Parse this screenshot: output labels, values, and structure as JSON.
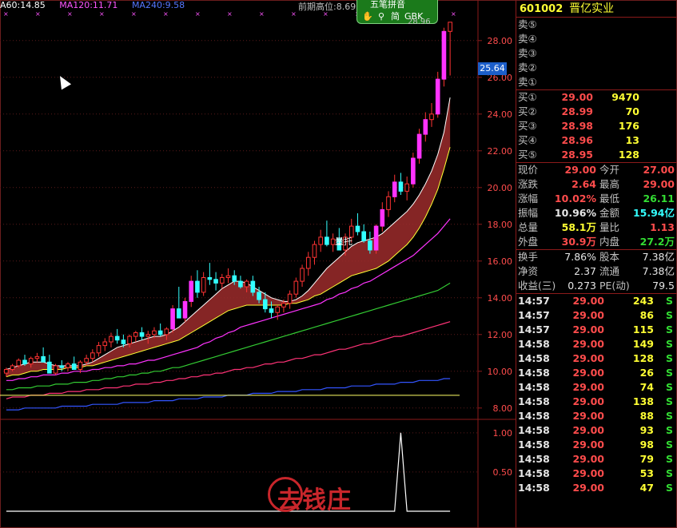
{
  "legend": [
    {
      "text": "A60:14.85",
      "color": "#ffffff"
    },
    {
      "text": "MA120:11.71",
      "color": "#ff55ff"
    },
    {
      "text": "MA240:9.58",
      "color": "#5577ff"
    }
  ],
  "prev_high_label": "前期高位:8.69",
  "toolbar": {
    "title": "五笔拼音",
    "simple": "简",
    "encoding": "GBK"
  },
  "current_price_tag": "25.64",
  "last_close_label": "28.96",
  "annotation": "量托",
  "colors": {
    "up": "#ff3333",
    "up_fill": "#ff33ff",
    "down": "#33ffff",
    "bg": "#000000",
    "grid": "#5a1a1a"
  },
  "chart_data": [
    {
      "type": "candlestick",
      "y_axis": {
        "ticks": [
          "28.00",
          "26.00",
          "24.00",
          "22.00",
          "20.00",
          "18.00",
          "16.00",
          "14.00",
          "12.00",
          "10.00",
          "8.00"
        ],
        "range": [
          7.6,
          29.6
        ]
      },
      "candles": [
        [
          9.9,
          10.2,
          9.7,
          10.1
        ],
        [
          10.1,
          10.4,
          10.0,
          10.3
        ],
        [
          10.3,
          10.7,
          10.2,
          10.6
        ],
        [
          10.6,
          10.9,
          10.3,
          10.4
        ],
        [
          10.4,
          10.8,
          10.2,
          10.7
        ],
        [
          10.7,
          11.0,
          10.5,
          10.8
        ],
        [
          10.8,
          11.3,
          10.6,
          10.5
        ],
        [
          10.5,
          10.9,
          10.2,
          9.9
        ],
        [
          9.9,
          10.4,
          9.8,
          10.3
        ],
        [
          10.3,
          10.6,
          10.0,
          10.2
        ],
        [
          10.2,
          10.5,
          10.0,
          10.4
        ],
        [
          10.4,
          10.8,
          10.2,
          10.1
        ],
        [
          10.1,
          10.6,
          9.9,
          10.5
        ],
        [
          10.5,
          10.9,
          10.3,
          10.7
        ],
        [
          10.7,
          11.2,
          10.5,
          11.0
        ],
        [
          11.0,
          11.6,
          10.8,
          11.4
        ],
        [
          11.4,
          11.8,
          11.1,
          11.6
        ],
        [
          11.6,
          12.1,
          11.3,
          11.9
        ],
        [
          11.9,
          12.3,
          11.5,
          11.7
        ],
        [
          11.7,
          12.0,
          11.3,
          11.5
        ],
        [
          11.5,
          12.0,
          11.3,
          11.9
        ],
        [
          11.9,
          12.2,
          11.6,
          12.1
        ],
        [
          12.1,
          12.4,
          11.7,
          11.9
        ],
        [
          11.9,
          12.2,
          11.5,
          12.0
        ],
        [
          12.0,
          12.4,
          11.8,
          12.2
        ],
        [
          12.2,
          12.6,
          11.9,
          12.0
        ],
        [
          12.0,
          12.4,
          11.7,
          12.3
        ],
        [
          12.3,
          13.6,
          12.1,
          13.4
        ],
        [
          13.4,
          14.6,
          13.0,
          12.9
        ],
        [
          12.9,
          14.0,
          12.7,
          13.8
        ],
        [
          13.8,
          15.2,
          13.5,
          14.9
        ],
        [
          14.9,
          15.5,
          14.0,
          14.3
        ],
        [
          14.3,
          15.4,
          14.1,
          15.1
        ],
        [
          15.1,
          15.9,
          14.7,
          15.0
        ],
        [
          15.0,
          15.4,
          14.4,
          14.8
        ],
        [
          14.8,
          15.3,
          14.5,
          15.1
        ],
        [
          15.1,
          15.6,
          14.8,
          15.2
        ],
        [
          15.2,
          15.5,
          14.7,
          14.9
        ],
        [
          14.9,
          15.2,
          14.5,
          14.6
        ],
        [
          14.6,
          15.0,
          14.3,
          14.9
        ],
        [
          14.9,
          15.2,
          14.1,
          14.3
        ],
        [
          14.3,
          14.6,
          13.7,
          13.9
        ],
        [
          13.9,
          14.3,
          13.2,
          13.4
        ],
        [
          13.4,
          13.8,
          12.9,
          13.2
        ],
        [
          13.2,
          13.6,
          12.8,
          13.5
        ],
        [
          13.5,
          13.9,
          13.2,
          13.7
        ],
        [
          13.7,
          14.4,
          13.4,
          14.2
        ],
        [
          14.2,
          15.1,
          14.0,
          14.9
        ],
        [
          14.9,
          15.8,
          14.6,
          15.6
        ],
        [
          15.6,
          16.5,
          15.2,
          16.2
        ],
        [
          16.2,
          17.1,
          15.8,
          16.9
        ],
        [
          16.9,
          17.7,
          16.5,
          17.3
        ],
        [
          17.3,
          18.2,
          16.8,
          16.9
        ],
        [
          16.9,
          17.5,
          16.5,
          17.2
        ],
        [
          17.2,
          17.8,
          16.8,
          16.6
        ],
        [
          16.6,
          17.5,
          16.3,
          17.3
        ],
        [
          17.3,
          18.3,
          17.0,
          17.9
        ],
        [
          17.9,
          18.6,
          17.4,
          17.6
        ],
        [
          17.6,
          18.0,
          17.0,
          17.1
        ],
        [
          17.1,
          17.6,
          16.4,
          16.6
        ],
        [
          16.6,
          18.0,
          16.4,
          17.9
        ],
        [
          17.9,
          19.2,
          17.6,
          18.8
        ],
        [
          18.8,
          19.8,
          18.4,
          19.5
        ],
        [
          19.5,
          20.7,
          19.2,
          20.3
        ],
        [
          20.3,
          20.8,
          19.6,
          19.8
        ],
        [
          19.8,
          20.6,
          19.3,
          20.2
        ],
        [
          20.2,
          21.9,
          20.0,
          21.6
        ],
        [
          21.6,
          23.2,
          21.3,
          22.9
        ],
        [
          22.9,
          24.1,
          22.5,
          23.7
        ],
        [
          23.7,
          24.6,
          23.3,
          24.0
        ],
        [
          24.0,
          26.3,
          23.8,
          25.9
        ],
        [
          25.9,
          28.7,
          25.5,
          28.5
        ],
        [
          28.5,
          29.0,
          26.1,
          29.0
        ]
      ],
      "ma_short": [
        10.1,
        10.2,
        10.3,
        10.4,
        10.5,
        10.5,
        10.5,
        10.4,
        10.3,
        10.3,
        10.3,
        10.3,
        10.3,
        10.4,
        10.5,
        10.7,
        10.9,
        11.1,
        11.3,
        11.4,
        11.5,
        11.6,
        11.7,
        11.8,
        11.9,
        11.9,
        12.0,
        12.2,
        12.4,
        12.7,
        13.0,
        13.3,
        13.6,
        13.9,
        14.2,
        14.5,
        14.7,
        14.9,
        14.9,
        14.8,
        14.6,
        14.4,
        14.2,
        14.0,
        13.9,
        13.8,
        13.8,
        13.9,
        14.1,
        14.4,
        14.8,
        15.2,
        15.6,
        15.9,
        16.2,
        16.5,
        16.8,
        17.0,
        17.1,
        17.2,
        17.3,
        17.5,
        17.8,
        18.1,
        18.4,
        18.7,
        19.1,
        19.6,
        20.2,
        20.9,
        21.8,
        23.0,
        24.9
      ],
      "ma_mid": [
        9.7,
        9.8,
        9.8,
        9.9,
        10.0,
        10.0,
        10.1,
        10.1,
        10.1,
        10.1,
        10.2,
        10.2,
        10.2,
        10.3,
        10.3,
        10.4,
        10.5,
        10.6,
        10.7,
        10.8,
        10.9,
        11.0,
        11.1,
        11.2,
        11.3,
        11.4,
        11.5,
        11.6,
        11.7,
        11.9,
        12.1,
        12.3,
        12.5,
        12.7,
        12.9,
        13.1,
        13.3,
        13.4,
        13.5,
        13.6,
        13.6,
        13.6,
        13.6,
        13.6,
        13.6,
        13.6,
        13.7,
        13.7,
        13.8,
        13.9,
        14.1,
        14.2,
        14.4,
        14.6,
        14.8,
        15.0,
        15.2,
        15.3,
        15.4,
        15.5,
        15.6,
        15.8,
        16.0,
        16.3,
        16.6,
        16.9,
        17.3,
        17.8,
        18.4,
        19.1,
        19.9,
        21.0,
        22.2
      ],
      "ma_mid_label": "short-mid pair fill",
      "ma_magenta": [
        9.5,
        9.5,
        9.6,
        9.6,
        9.7,
        9.7,
        9.8,
        9.8,
        9.8,
        9.9,
        9.9,
        10.0,
        10.0,
        10.0,
        10.1,
        10.1,
        10.2,
        10.2,
        10.3,
        10.3,
        10.4,
        10.4,
        10.5,
        10.6,
        10.6,
        10.7,
        10.8,
        10.9,
        11.0,
        11.1,
        11.2,
        11.3,
        11.5,
        11.6,
        11.8,
        11.9,
        12.1,
        12.2,
        12.4,
        12.5,
        12.6,
        12.7,
        12.8,
        12.9,
        13.0,
        13.1,
        13.2,
        13.3,
        13.4,
        13.5,
        13.6,
        13.7,
        13.9,
        14.0,
        14.2,
        14.3,
        14.5,
        14.6,
        14.8,
        14.9,
        15.1,
        15.3,
        15.5,
        15.7,
        15.9,
        16.1,
        16.3,
        16.6,
        16.9,
        17.2,
        17.5,
        17.9,
        18.3
      ],
      "ma_green": [
        9.0,
        9.0,
        9.1,
        9.1,
        9.1,
        9.2,
        9.2,
        9.2,
        9.3,
        9.3,
        9.3,
        9.4,
        9.4,
        9.4,
        9.5,
        9.5,
        9.6,
        9.6,
        9.7,
        9.7,
        9.8,
        9.8,
        9.9,
        9.9,
        10.0,
        10.0,
        10.1,
        10.2,
        10.2,
        10.3,
        10.4,
        10.5,
        10.6,
        10.7,
        10.8,
        10.9,
        11.0,
        11.1,
        11.2,
        11.3,
        11.4,
        11.5,
        11.6,
        11.7,
        11.8,
        11.9,
        12.0,
        12.1,
        12.2,
        12.3,
        12.4,
        12.5,
        12.6,
        12.7,
        12.8,
        12.9,
        13.0,
        13.1,
        13.2,
        13.3,
        13.4,
        13.5,
        13.6,
        13.7,
        13.8,
        13.9,
        14.0,
        14.1,
        14.2,
        14.3,
        14.4,
        14.6,
        14.8
      ],
      "ma_pink": [
        8.5,
        8.6,
        8.6,
        8.6,
        8.7,
        8.7,
        8.7,
        8.8,
        8.8,
        8.8,
        8.9,
        8.9,
        8.9,
        9.0,
        9.0,
        9.0,
        9.1,
        9.1,
        9.1,
        9.2,
        9.2,
        9.3,
        9.3,
        9.3,
        9.4,
        9.4,
        9.5,
        9.5,
        9.6,
        9.6,
        9.7,
        9.7,
        9.8,
        9.8,
        9.9,
        9.9,
        10.0,
        10.1,
        10.1,
        10.2,
        10.2,
        10.3,
        10.4,
        10.4,
        10.5,
        10.5,
        10.6,
        10.7,
        10.7,
        10.8,
        10.9,
        10.9,
        11.0,
        11.1,
        11.2,
        11.2,
        11.3,
        11.4,
        11.5,
        11.5,
        11.6,
        11.7,
        11.8,
        11.9,
        11.9,
        12.0,
        12.1,
        12.2,
        12.3,
        12.4,
        12.5,
        12.6,
        12.7
      ],
      "ma_blue": [
        7.9,
        7.9,
        7.9,
        8.0,
        8.0,
        8.0,
        8.0,
        8.0,
        8.0,
        8.1,
        8.1,
        8.1,
        8.1,
        8.1,
        8.2,
        8.2,
        8.2,
        8.2,
        8.2,
        8.3,
        8.3,
        8.3,
        8.3,
        8.3,
        8.4,
        8.4,
        8.4,
        8.4,
        8.5,
        8.5,
        8.5,
        8.5,
        8.6,
        8.6,
        8.6,
        8.6,
        8.7,
        8.7,
        8.7,
        8.7,
        8.8,
        8.8,
        8.8,
        8.8,
        8.9,
        8.9,
        8.9,
        8.9,
        9.0,
        9.0,
        9.0,
        9.0,
        9.1,
        9.1,
        9.1,
        9.1,
        9.2,
        9.2,
        9.2,
        9.2,
        9.3,
        9.3,
        9.3,
        9.3,
        9.4,
        9.4,
        9.4,
        9.5,
        9.5,
        9.5,
        9.5,
        9.6,
        9.6
      ],
      "prev_high": 8.69
    },
    {
      "type": "line",
      "y_axis": {
        "ticks": [
          "1.00",
          "0.50"
        ],
        "range": [
          0,
          1.1
        ]
      },
      "values": [
        0,
        0,
        0,
        0,
        0,
        0,
        0,
        0,
        0,
        0,
        0,
        0,
        0,
        0,
        0,
        0,
        0,
        0,
        0,
        0,
        0,
        0,
        0,
        0,
        0,
        0,
        0,
        0,
        0,
        0,
        0,
        0,
        0,
        0,
        0,
        0,
        0,
        0,
        0,
        0,
        0,
        0,
        0,
        0,
        0,
        0,
        0,
        0,
        0,
        0,
        0,
        0,
        0,
        0,
        0,
        0,
        0,
        0,
        0,
        0,
        0,
        0,
        0,
        0,
        1,
        0,
        0,
        0,
        0,
        0,
        0,
        0,
        0
      ]
    }
  ],
  "quote": {
    "code": "601002",
    "name": "晋亿实业",
    "asks": [
      {
        "label": "卖⑤",
        "price": "",
        "vol": ""
      },
      {
        "label": "卖④",
        "price": "",
        "vol": ""
      },
      {
        "label": "卖③",
        "price": "",
        "vol": ""
      },
      {
        "label": "卖②",
        "price": "",
        "vol": ""
      },
      {
        "label": "卖①",
        "price": "",
        "vol": ""
      }
    ],
    "bids": [
      {
        "label": "买①",
        "price": "29.00",
        "vol": "9470"
      },
      {
        "label": "买②",
        "price": "28.99",
        "vol": "70"
      },
      {
        "label": "买③",
        "price": "28.98",
        "vol": "176"
      },
      {
        "label": "买④",
        "price": "28.96",
        "vol": "13"
      },
      {
        "label": "买⑤",
        "price": "28.95",
        "vol": "128"
      }
    ],
    "stats": [
      {
        "l1": "现价",
        "v1": "29.00",
        "c1": "red",
        "l2": "今开",
        "v2": "27.00",
        "c2": "red"
      },
      {
        "l1": "涨跌",
        "v1": "2.64",
        "c1": "red",
        "l2": "最高",
        "v2": "29.00",
        "c2": "red"
      },
      {
        "l1": "涨幅",
        "v1": "10.02%",
        "c1": "red",
        "l2": "最低",
        "v2": "26.11",
        "c2": "green"
      },
      {
        "l1": "振幅",
        "v1": "10.96%",
        "c1": "white",
        "l2": "金额",
        "v2": "15.94亿",
        "c2": "cyan"
      },
      {
        "l1": "总量",
        "v1": "58.1万",
        "c1": "yellow",
        "l2": "量比",
        "v2": "1.13",
        "c2": "red"
      },
      {
        "l1": "外盘",
        "v1": "30.9万",
        "c1": "red",
        "l2": "内盘",
        "v2": "27.2万",
        "c2": "green"
      }
    ],
    "info": [
      {
        "l1": "换手",
        "v1": "7.86%",
        "l2": "股本",
        "v2": "7.38亿"
      },
      {
        "l1": "净资",
        "v1": "2.37",
        "l2": "流通",
        "v2": "7.38亿"
      },
      {
        "l1": "收益(三)",
        "v1": "0.273",
        "l2": "PE(动)",
        "v2": "79.5"
      }
    ],
    "ticks": [
      {
        "time": "14:57",
        "price": "29.00",
        "vol": "243",
        "side": "S"
      },
      {
        "time": "14:57",
        "price": "29.00",
        "vol": "86",
        "side": "S"
      },
      {
        "time": "14:57",
        "price": "29.00",
        "vol": "115",
        "side": "S"
      },
      {
        "time": "14:58",
        "price": "29.00",
        "vol": "149",
        "side": "S"
      },
      {
        "time": "14:58",
        "price": "29.00",
        "vol": "128",
        "side": "S"
      },
      {
        "time": "14:58",
        "price": "29.00",
        "vol": "26",
        "side": "S"
      },
      {
        "time": "14:58",
        "price": "29.00",
        "vol": "74",
        "side": "S"
      },
      {
        "time": "14:58",
        "price": "29.00",
        "vol": "138",
        "side": "S"
      },
      {
        "time": "14:58",
        "price": "29.00",
        "vol": "88",
        "side": "S"
      },
      {
        "time": "14:58",
        "price": "29.00",
        "vol": "93",
        "side": "S"
      },
      {
        "time": "14:58",
        "price": "29.00",
        "vol": "98",
        "side": "S"
      },
      {
        "time": "14:58",
        "price": "29.00",
        "vol": "79",
        "side": "S"
      },
      {
        "time": "14:58",
        "price": "29.00",
        "vol": "53",
        "side": "S"
      },
      {
        "time": "14:58",
        "price": "29.00",
        "vol": "47",
        "side": "S"
      }
    ]
  },
  "watermark": "去钱庄"
}
